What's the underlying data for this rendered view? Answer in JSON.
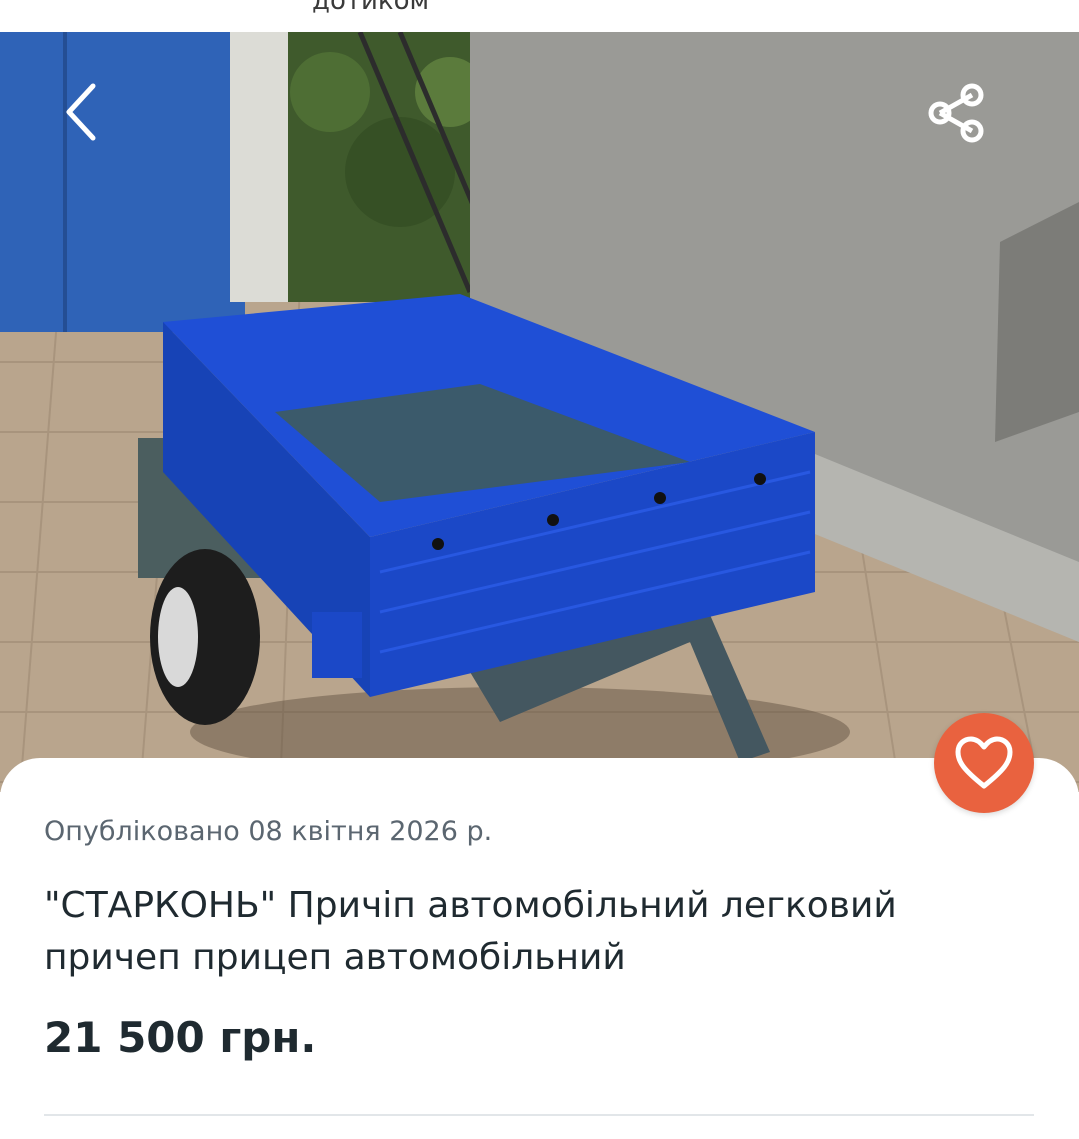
{
  "header": {
    "partial_text": "дотиком"
  },
  "gallery": {
    "back_icon": "chevron-left-icon",
    "share_icon": "share-icon",
    "favorite_icon": "heart-icon",
    "photo": "trailer-photo",
    "favorite_color": "#e9623f"
  },
  "listing": {
    "published": "Опубліковано 08 квітня 2026 р.",
    "title": "\"СТАРКОНЬ\" Причіп автомобільний легковий причеп прицеп автомобільний",
    "price": "21 500 грн."
  }
}
